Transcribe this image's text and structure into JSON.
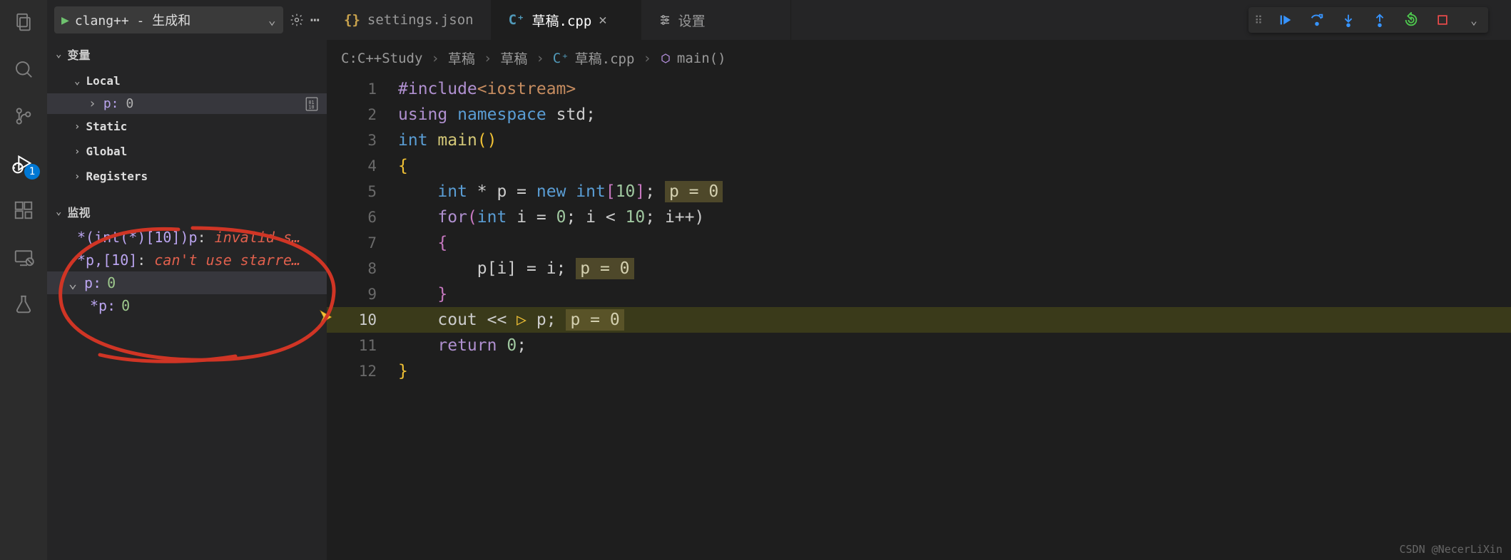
{
  "activity": {
    "debug_badge": "1"
  },
  "sidebar": {
    "launch_config": "clang++ - 生成和",
    "vars_label": "变量",
    "scopes": {
      "local": "Local",
      "static": "Static",
      "global": "Global",
      "registers": "Registers"
    },
    "local_var": {
      "name": "p:",
      "value": "0"
    },
    "watch_label": "监视",
    "watch_items": [
      {
        "expr": "*(int(*)[10])p",
        "error": "invalid s…"
      },
      {
        "expr": "*p,[10]",
        "error": "can't use starre…"
      }
    ],
    "watch_expanded": {
      "name": "p:",
      "value": "0",
      "child_name": "*p:",
      "child_value": "0"
    }
  },
  "tabs": {
    "settings_json": "settings.json",
    "draft_cpp": "草稿.cpp",
    "settings": "设置"
  },
  "breadcrumb": {
    "seg1": "C:C++Study",
    "seg2": "草稿",
    "seg3": "草稿",
    "seg4": "草稿.cpp",
    "seg5": "main()"
  },
  "code": {
    "lines": [
      "1",
      "2",
      "3",
      "4",
      "5",
      "6",
      "7",
      "8",
      "9",
      "10",
      "11",
      "12"
    ],
    "l1": {
      "a": "#include",
      "b": "<iostream>"
    },
    "l2": {
      "a": "using",
      "b": "namespace",
      "c": "std",
      "d": ";"
    },
    "l3": {
      "a": "int",
      "b": "main",
      "c": "()"
    },
    "l4": {
      "a": "{"
    },
    "l5": {
      "a": "int",
      "b": "* p = ",
      "c": "new",
      "d": "int",
      "e": "[",
      "f": "10",
      "g": "];",
      "hint": "p = 0"
    },
    "l6": {
      "a": "for",
      "b": "(",
      "c": "int",
      "d": " i = ",
      "e": "0",
      "f": "; i < ",
      "g": "10",
      "h": "; i++)"
    },
    "l7": {
      "a": "{"
    },
    "l8": {
      "a": "p[i] = i;",
      "hint": "p = 0"
    },
    "l9": {
      "a": "}"
    },
    "l10": {
      "a": "cout",
      "b": " << ",
      "c": "p;",
      "hint": "p = 0"
    },
    "l11": {
      "a": "return",
      "b": "0",
      "c": ";"
    },
    "l12": {
      "a": "}"
    }
  },
  "watermark": "CSDN @NecerLiXin"
}
